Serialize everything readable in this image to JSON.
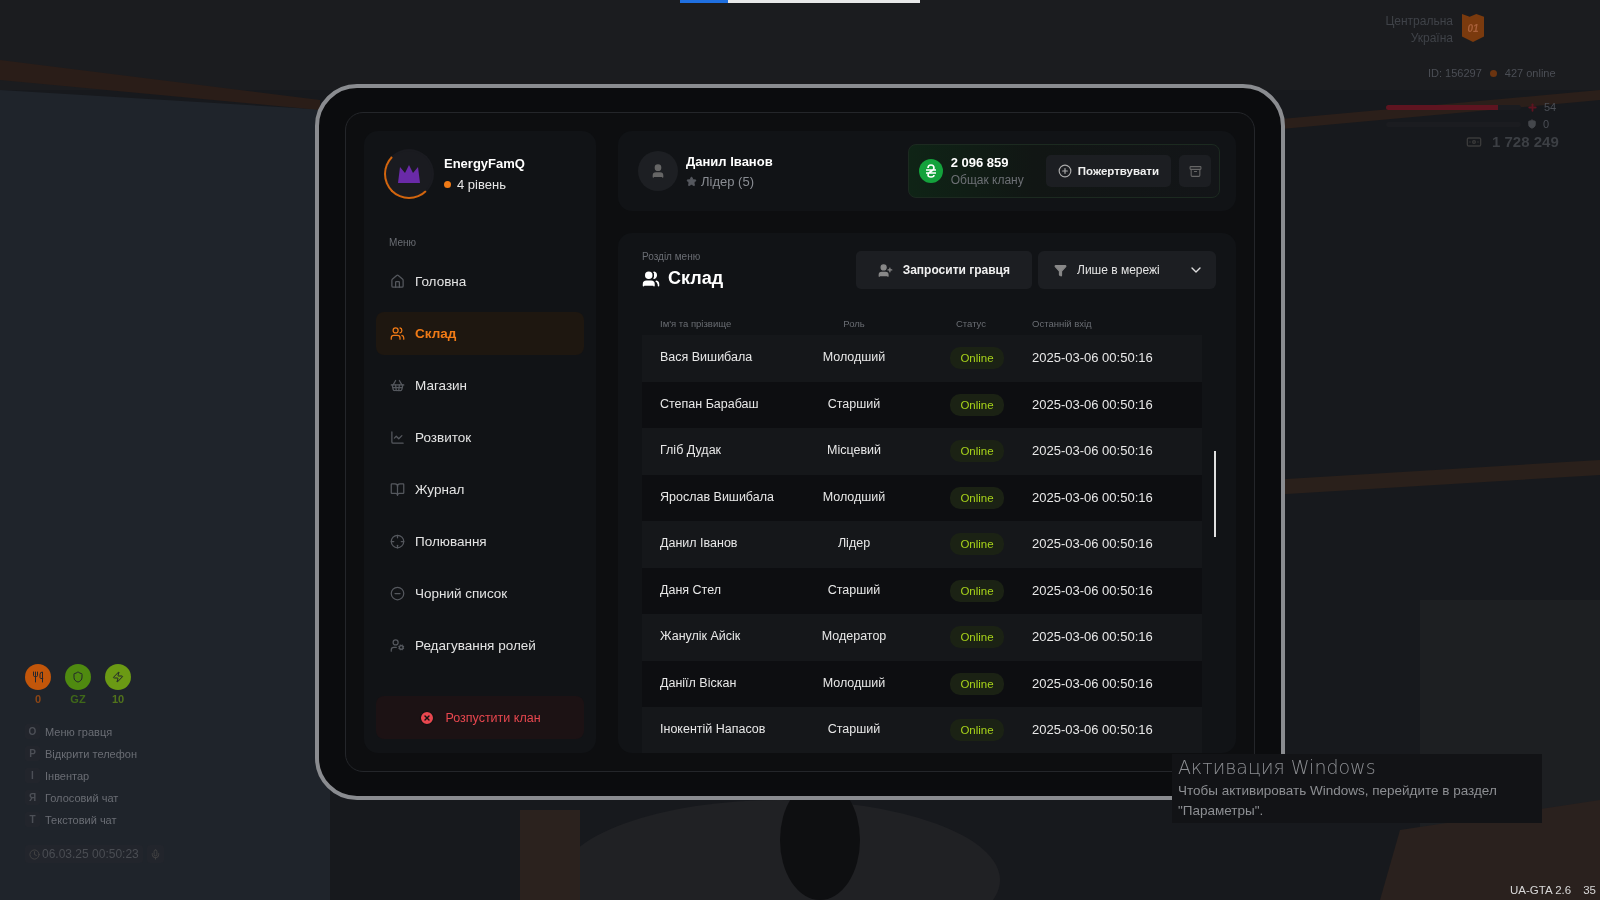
{
  "top_bar": {
    "level": 0.2
  },
  "hud_left": {
    "stats": [
      {
        "label": "0",
        "color": "#c2560a"
      },
      {
        "label": "GZ",
        "color": "#4f8a10"
      },
      {
        "label": "10",
        "color": "#6b9a14"
      }
    ],
    "hints": [
      {
        "key": "O",
        "label": "Меню гравця"
      },
      {
        "key": "P",
        "label": "Відкрити телефон"
      },
      {
        "key": "I",
        "label": "Інвентар"
      },
      {
        "key": "Я",
        "label": "Голосовий чат"
      },
      {
        "key": "T",
        "label": "Текстовий чат"
      }
    ],
    "clock": "06.03.25 00:50:23"
  },
  "hud_right": {
    "region": "Центральна Україна",
    "region_badge": "01",
    "player_id": "ID: 156297",
    "online": "427 online",
    "health": {
      "level": 0.83,
      "value": "54"
    },
    "armor": {
      "value": "0"
    },
    "money": "1 728 249"
  },
  "sidebar": {
    "clan_name": "EnergyFamQ",
    "clan_level": "4 рівень",
    "menu_label": "Меню",
    "items": [
      {
        "label": "Головна",
        "selected": false
      },
      {
        "label": "Склад",
        "selected": true
      },
      {
        "label": "Магазин",
        "selected": false
      },
      {
        "label": "Розвиток",
        "selected": false
      },
      {
        "label": "Журнал",
        "selected": false
      },
      {
        "label": "Полювання",
        "selected": false
      },
      {
        "label": "Чорний список",
        "selected": false
      },
      {
        "label": "Редагування ролей",
        "selected": false
      }
    ],
    "disband_button": "Розпустити клан"
  },
  "header": {
    "user_name": "Данил Іванов",
    "user_role": "Лідер (5)",
    "balance": "2 096 859",
    "balance_label": "Общак клану",
    "donate_button": "Пожертвувати"
  },
  "section": {
    "caption": "Розділ меню",
    "title": "Склад",
    "invite_button": "Запросити гравця",
    "filter": "Лише в мережі"
  },
  "table": {
    "columns": [
      "Ім'я та прізвище",
      "Роль",
      "Статус",
      "Останній вхід"
    ],
    "rows": [
      {
        "name": "Вася Вишибала",
        "role": "Молодший",
        "status": "Online",
        "last": "2025-03-06 00:50:16"
      },
      {
        "name": "Степан Барабаш",
        "role": "Старший",
        "status": "Online",
        "last": "2025-03-06 00:50:16"
      },
      {
        "name": "Гліб Дудак",
        "role": "Місцевий",
        "status": "Online",
        "last": "2025-03-06 00:50:16"
      },
      {
        "name": "Ярослав Вишибала",
        "role": "Молодший",
        "status": "Online",
        "last": "2025-03-06 00:50:16"
      },
      {
        "name": "Данил Іванов",
        "role": "Лідер",
        "status": "Online",
        "last": "2025-03-06 00:50:16"
      },
      {
        "name": "Даня Стел",
        "role": "Старший",
        "status": "Online",
        "last": "2025-03-06 00:50:16"
      },
      {
        "name": "Жанулік Айсік",
        "role": "Модератор",
        "status": "Online",
        "last": "2025-03-06 00:50:16"
      },
      {
        "name": "Даніїл Віскан",
        "role": "Молодший",
        "status": "Online",
        "last": "2025-03-06 00:50:16"
      },
      {
        "name": "Інокентій Напасов",
        "role": "Старший",
        "status": "Online",
        "last": "2025-03-06 00:50:16"
      }
    ]
  },
  "os_notice": {
    "title": "Активация Windows",
    "text": "Чтобы активировать Windows, перейдите в раздел \"Параметры\"."
  },
  "build": {
    "version": "UA-GTA 2.6",
    "fps": "35"
  }
}
